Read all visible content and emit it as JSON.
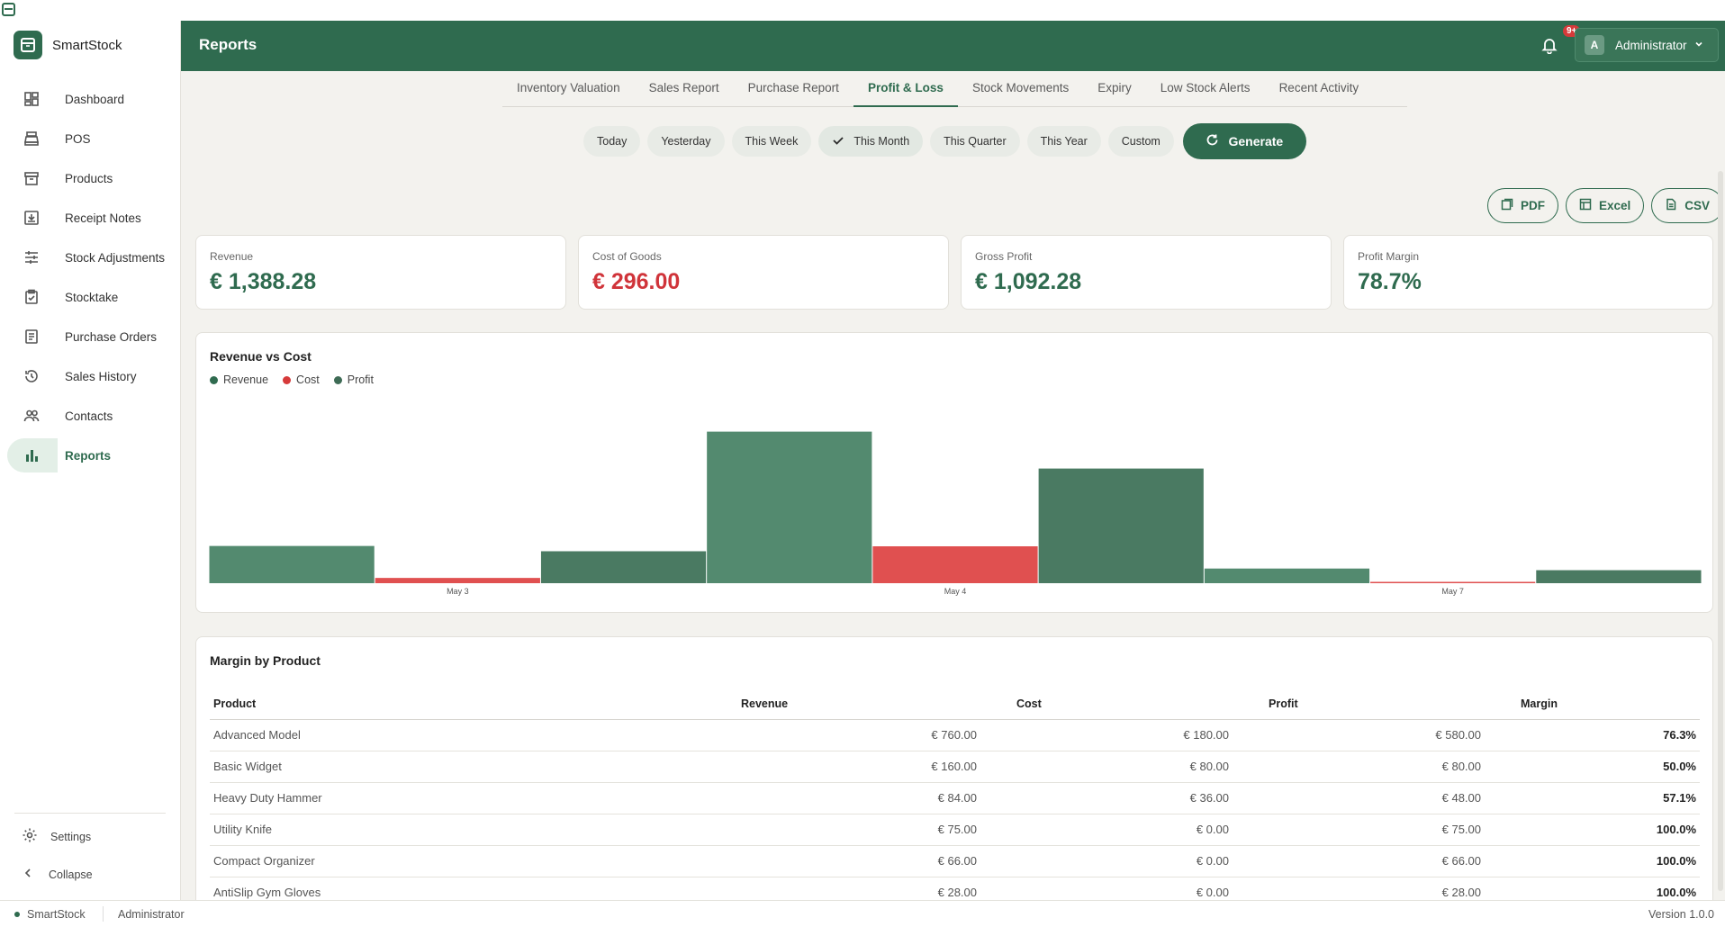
{
  "app": {
    "name": "SmartStock"
  },
  "colors": {
    "primary": "#2f6b4f",
    "revenue": "#538a6f",
    "cost": "#e05050",
    "profit": "#4a7a62",
    "negative": "#d0343a"
  },
  "sidebar": {
    "items": [
      {
        "label": "Dashboard",
        "icon": "dashboard-icon"
      },
      {
        "label": "POS",
        "icon": "pos-register-icon"
      },
      {
        "label": "Products",
        "icon": "box-icon"
      },
      {
        "label": "Receipt Notes",
        "icon": "receipt-download-icon"
      },
      {
        "label": "Stock Adjustments",
        "icon": "sliders-icon"
      },
      {
        "label": "Stocktake",
        "icon": "clipboard-check-icon"
      },
      {
        "label": "Purchase Orders",
        "icon": "document-list-icon"
      },
      {
        "label": "Sales History",
        "icon": "history-icon"
      },
      {
        "label": "Contacts",
        "icon": "people-icon"
      },
      {
        "label": "Reports",
        "icon": "bar-chart-icon",
        "active": true
      }
    ],
    "settings_label": "Settings",
    "collapse_label": "Collapse"
  },
  "header": {
    "title": "Reports",
    "notification_badge": "9+",
    "user_initial": "A",
    "user_name": "Administrator"
  },
  "tabs": [
    "Inventory Valuation",
    "Sales Report",
    "Purchase Report",
    "Profit & Loss",
    "Stock Movements",
    "Expiry",
    "Low Stock Alerts",
    "Recent Activity"
  ],
  "active_tab": "Profit & Loss",
  "periods": [
    "Today",
    "Yesterday",
    "This Week",
    "This Month",
    "This Quarter",
    "This Year",
    "Custom"
  ],
  "selected_period": "This Month",
  "generate_label": "Generate",
  "exports": [
    "PDF",
    "Excel",
    "CSV"
  ],
  "kpis": [
    {
      "label": "Revenue",
      "value": "€ 1,388.28",
      "tone": "positive"
    },
    {
      "label": "Cost of Goods",
      "value": "€ 296.00",
      "tone": "negative"
    },
    {
      "label": "Gross Profit",
      "value": "€ 1,092.28",
      "tone": "positive"
    },
    {
      "label": "Profit Margin",
      "value": "78.7%",
      "tone": "positive"
    }
  ],
  "chart_data": {
    "type": "bar",
    "title": "Revenue vs Cost",
    "categories": [
      "May 3",
      "May 4",
      "May 7"
    ],
    "series": [
      {
        "name": "Revenue",
        "values": [
          226,
          920,
          89
        ]
      },
      {
        "name": "Cost",
        "values": [
          32,
          224,
          0
        ]
      },
      {
        "name": "Profit",
        "values": [
          194,
          696,
          79
        ]
      }
    ],
    "ylim": [
      0,
      1000
    ],
    "legend": "top-left",
    "grid": false
  },
  "margin_table": {
    "title": "Margin by Product",
    "columns": [
      "Product",
      "Revenue",
      "Cost",
      "Profit",
      "Margin"
    ],
    "rows": [
      [
        "Advanced Model",
        "€ 760.00",
        "€ 180.00",
        "€ 580.00",
        "76.3%"
      ],
      [
        "Basic Widget",
        "€ 160.00",
        "€ 80.00",
        "€ 80.00",
        "50.0%"
      ],
      [
        "Heavy Duty Hammer",
        "€ 84.00",
        "€ 36.00",
        "€ 48.00",
        "57.1%"
      ],
      [
        "Utility Knife",
        "€ 75.00",
        "€ 0.00",
        "€ 75.00",
        "100.0%"
      ],
      [
        "Compact Organizer",
        "€ 66.00",
        "€ 0.00",
        "€ 66.00",
        "100.0%"
      ],
      [
        "AntiSlip Gym Gloves",
        "€ 28.00",
        "€ 0.00",
        "€ 28.00",
        "100.0%"
      ]
    ]
  },
  "statusbar": {
    "app": "SmartStock",
    "user": "Administrator",
    "version": "Version 1.0.0"
  }
}
